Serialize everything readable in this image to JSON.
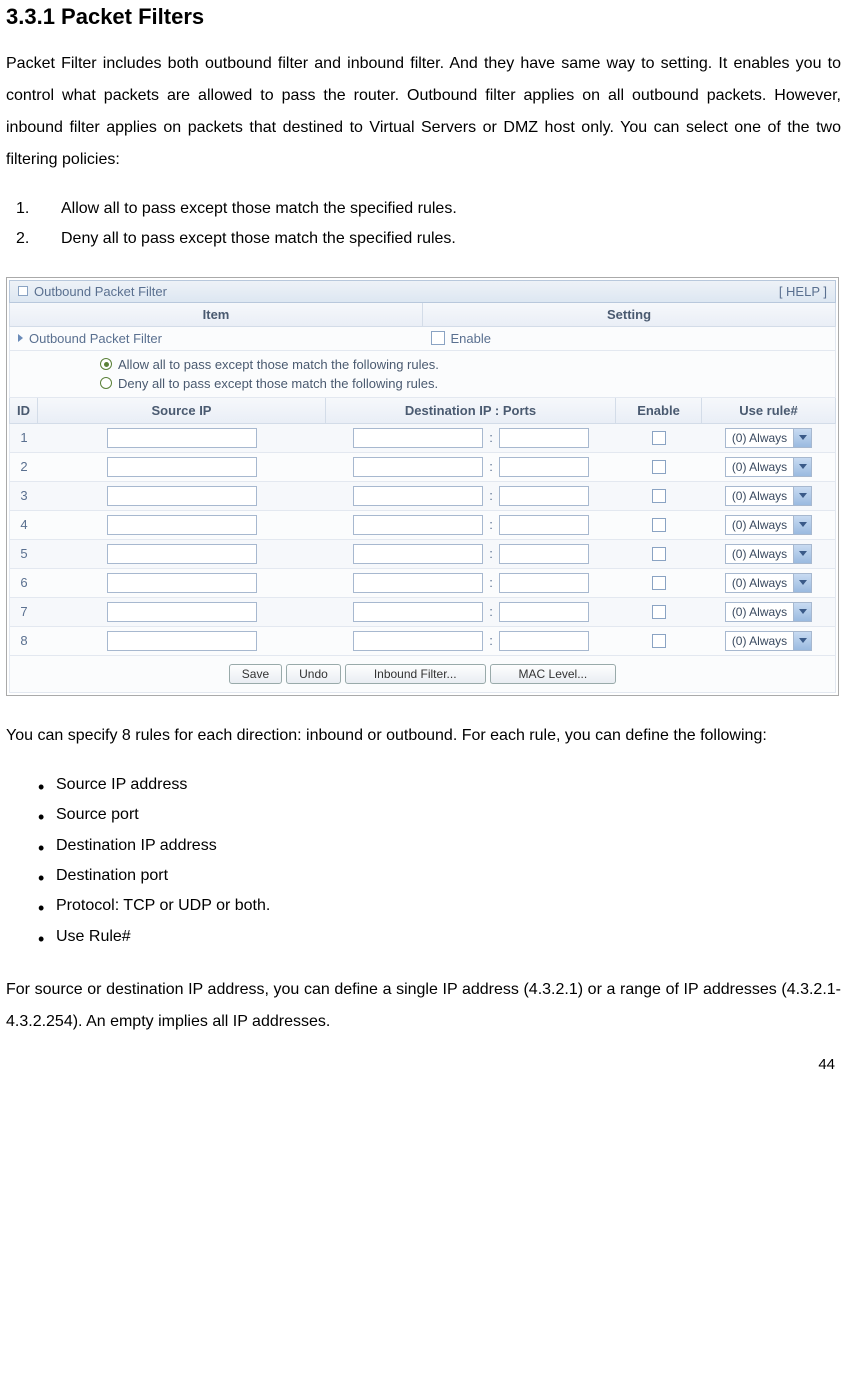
{
  "heading": "3.3.1 Packet Filters",
  "intro": "Packet Filter includes both outbound filter and inbound filter. And they have same way to setting. It enables you to control what packets are allowed to pass the router. Outbound filter applies on all outbound packets. However, inbound filter applies on packets that destined to Virtual Servers or DMZ host only. You can select one of the two filtering policies:",
  "numbered": [
    {
      "num": "1.",
      "text": "Allow all to pass except those match the specified rules."
    },
    {
      "num": "2.",
      "text": "Deny all to pass except those match the specified rules."
    }
  ],
  "panel": {
    "title": "Outbound Packet Filter",
    "help": "[ HELP ]",
    "col_item": "Item",
    "col_setting": "Setting",
    "opf_label": "Outbound Packet Filter",
    "enable_label": "Enable",
    "policy_allow": "Allow all to pass except those match the following rules.",
    "policy_deny": "Deny all to pass except those match the following rules.",
    "headers": {
      "id": "ID",
      "src": "Source IP",
      "dst": "Destination IP : Ports",
      "enable": "Enable",
      "rule": "Use rule#"
    },
    "rows": [
      {
        "id": "1",
        "rule_text": "(0) Always"
      },
      {
        "id": "2",
        "rule_text": "(0) Always"
      },
      {
        "id": "3",
        "rule_text": "(0) Always"
      },
      {
        "id": "4",
        "rule_text": "(0) Always"
      },
      {
        "id": "5",
        "rule_text": "(0) Always"
      },
      {
        "id": "6",
        "rule_text": "(0) Always"
      },
      {
        "id": "7",
        "rule_text": "(0) Always"
      },
      {
        "id": "8",
        "rule_text": "(0) Always"
      }
    ],
    "buttons": {
      "save": "Save",
      "undo": "Undo",
      "inbound": "Inbound Filter...",
      "mac": "MAC Level..."
    }
  },
  "para2": "You can specify 8 rules for each direction: inbound or outbound. For each rule, you can define the following:",
  "bullets": [
    "Source IP address",
    "Source port",
    "Destination IP address",
    "Destination port",
    "Protocol: TCP or UDP or both.",
    "Use Rule#"
  ],
  "para3": "For source or destination IP address, you can define a single IP address (4.3.2.1) or a range of IP addresses (4.3.2.1-4.3.2.254). An empty implies all IP addresses.",
  "page_num": "44"
}
